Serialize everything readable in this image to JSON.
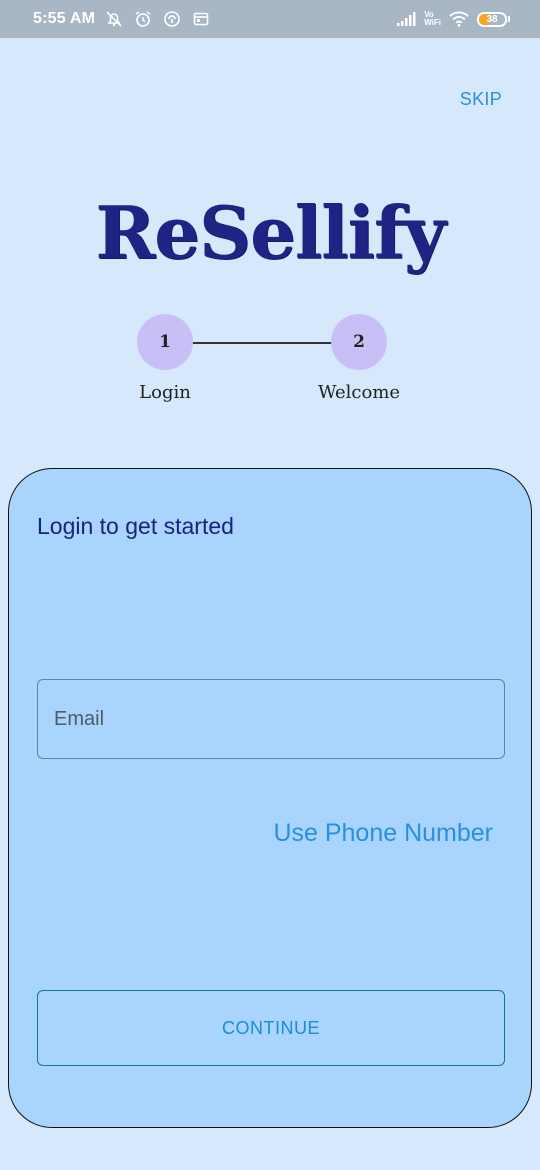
{
  "status_bar": {
    "time": "5:55 AM",
    "network_label_top": "Vo",
    "network_label_bottom": "WiFi",
    "battery_percent": "38"
  },
  "header": {
    "skip_label": "SKIP",
    "logo_text": "ReSellify"
  },
  "stepper": {
    "steps": [
      {
        "number": "1",
        "label": "Login"
      },
      {
        "number": "2",
        "label": "Welcome"
      }
    ]
  },
  "login_card": {
    "title": "Login to get started",
    "email_placeholder": "Email",
    "email_value": "",
    "phone_link_label": "Use Phone Number",
    "continue_label": "CONTINUE"
  },
  "colors": {
    "background": "#d6e8fb",
    "card": "#a8d4fd",
    "accent_link": "#2b8fe0",
    "logo": "#1f2383",
    "step_circle": "#c8bff6"
  }
}
